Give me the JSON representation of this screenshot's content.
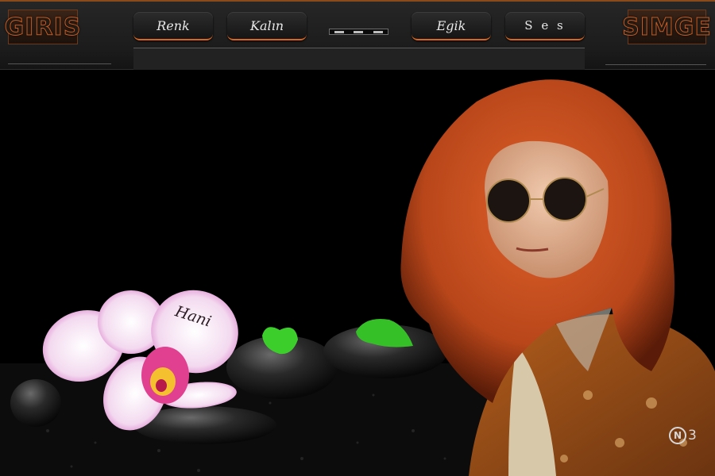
{
  "header": {
    "logo_left": "GIRIS",
    "logo_right": "SIMGE",
    "buttons": {
      "color": "Renk",
      "bold": "Kalın",
      "italic": "Egik",
      "sound": "S e s"
    },
    "message_bar_value": ""
  },
  "scene": {
    "signature": "Hani",
    "watermark_letter": "N",
    "watermark_number": "3"
  },
  "colors": {
    "accent": "#d9651f",
    "bar_bg": "#222222",
    "hair": "#c4501a",
    "jacket": "#9c4f16"
  },
  "icons": [
    "volume-slider"
  ]
}
